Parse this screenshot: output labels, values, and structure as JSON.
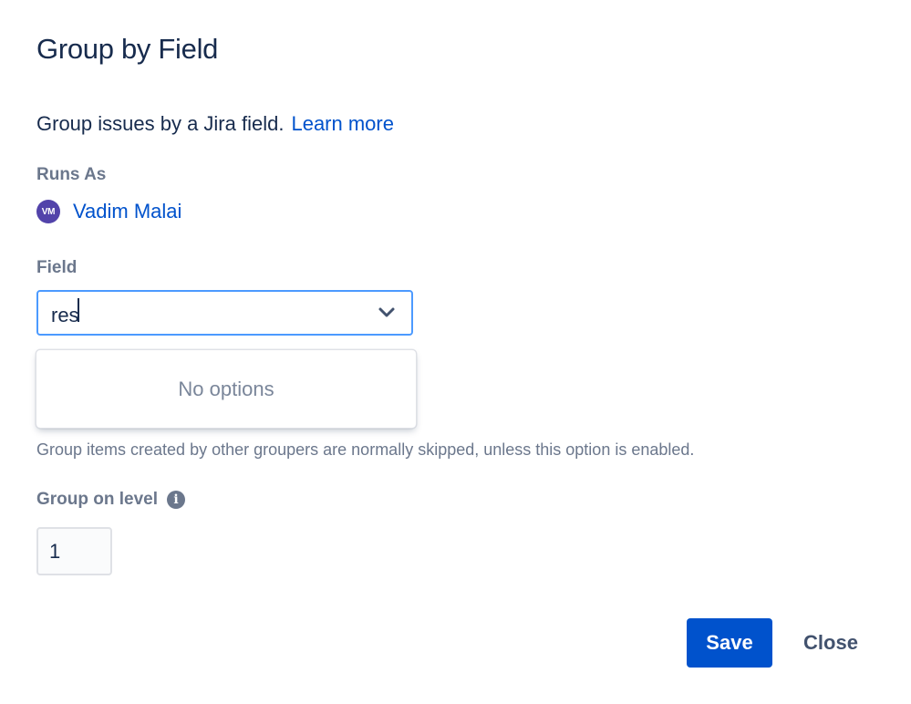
{
  "dialog": {
    "title": "Group by Field",
    "description": "Group issues by a Jira field.",
    "learn_more": "Learn more"
  },
  "runs_as": {
    "label": "Runs As",
    "avatar_initials": "VM",
    "user_name": "Vadim Malai",
    "avatar_color": "#5243aa"
  },
  "field": {
    "label": "Field",
    "value": "res",
    "dropdown_icon": "chevron-down-icon",
    "no_options_text": "No options"
  },
  "helper_text": "Group items created by other groupers are normally skipped, unless this option is enabled.",
  "group_level": {
    "label": "Group on level",
    "info_icon": "info-icon",
    "value": "1"
  },
  "footer": {
    "save_label": "Save",
    "close_label": "Close"
  },
  "colors": {
    "primary": "#0052cc",
    "focus_border": "#4c9aff",
    "text": "#172b4d",
    "subtle_text": "#6b778c"
  }
}
